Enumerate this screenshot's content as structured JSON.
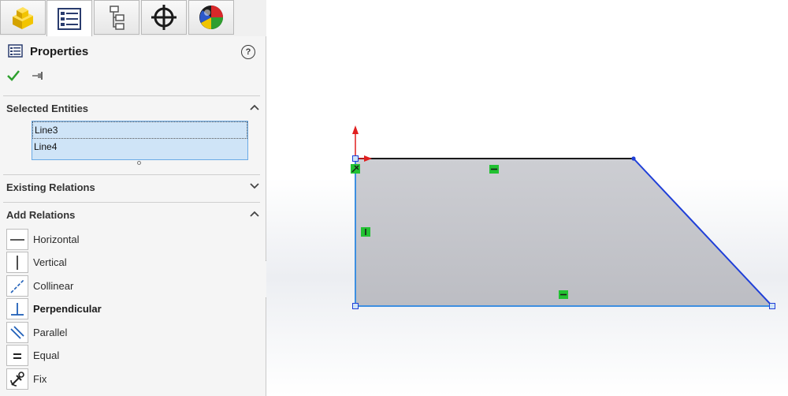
{
  "tabs": [
    {
      "name": "feature-manager-tab",
      "icon": "part-icon",
      "active": false
    },
    {
      "name": "property-manager-tab",
      "icon": "property-list-icon",
      "active": true
    },
    {
      "name": "configuration-manager-tab",
      "icon": "configuration-tree-icon",
      "active": false
    },
    {
      "name": "dimxpert-tab",
      "icon": "crosshair-icon",
      "active": false
    },
    {
      "name": "display-manager-tab",
      "icon": "appearance-sphere-icon",
      "active": false
    }
  ],
  "property_manager": {
    "title": "Properties",
    "help_label": "?",
    "ok_icon": "checkmark-icon",
    "pin_icon": "pushpin-icon"
  },
  "selected_entities": {
    "title": "Selected Entities",
    "items": [
      "Line3",
      "Line4"
    ],
    "expanded": true
  },
  "existing_relations": {
    "title": "Existing Relations",
    "expanded": false
  },
  "add_relations": {
    "title": "Add Relations",
    "expanded": true,
    "items": [
      {
        "label": "Horizontal",
        "icon": "horizontal-relation-icon",
        "emphasized": false
      },
      {
        "label": "Vertical",
        "icon": "vertical-relation-icon",
        "emphasized": false
      },
      {
        "label": "Collinear",
        "icon": "collinear-relation-icon",
        "emphasized": false
      },
      {
        "label": "Perpendicular",
        "icon": "perpendicular-relation-icon",
        "emphasized": true
      },
      {
        "label": "Parallel",
        "icon": "parallel-relation-icon",
        "emphasized": false
      },
      {
        "label": "Equal",
        "icon": "equal-relation-icon",
        "emphasized": false
      },
      {
        "label": "Fix",
        "icon": "fix-relation-icon",
        "emphasized": false
      }
    ]
  },
  "colors": {
    "sketch_fill": "#c8c9ce",
    "selected_line": "#3d8fe0",
    "sketch_line": "#1a1a1a",
    "diagonal_line": "#1f3fd8",
    "relation_marker": "#22c132",
    "origin_arrow": "#e01f1f",
    "ok_check": "#2ea02e"
  }
}
